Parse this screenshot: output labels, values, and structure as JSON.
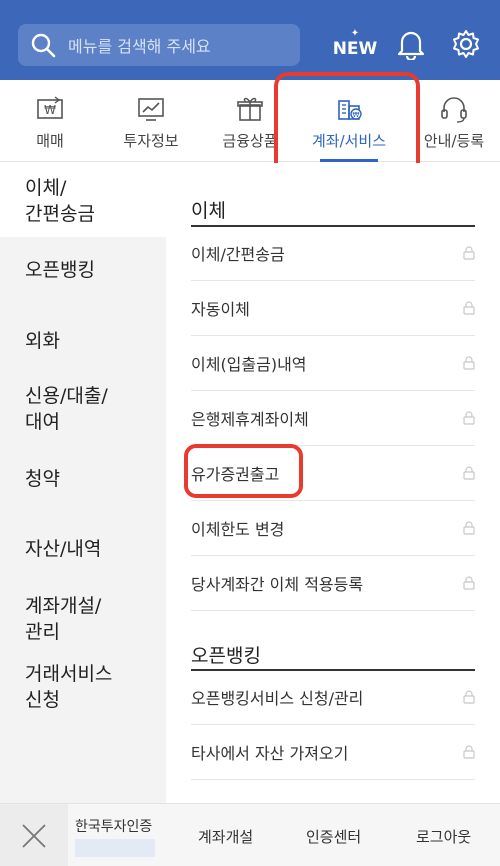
{
  "header": {
    "search_placeholder": "메뉴를 검색해 주세요",
    "new_label": "NEW",
    "brand_color": "#3d67b8"
  },
  "tabs": [
    {
      "label": "매매",
      "icon": "won-exchange-icon"
    },
    {
      "label": "투자정보",
      "icon": "chart-icon"
    },
    {
      "label": "금융상품",
      "icon": "gift-icon"
    },
    {
      "label": "계좌/서비스",
      "icon": "bank-building-icon",
      "active": true
    },
    {
      "label": "안내/등록",
      "icon": "headset-icon"
    }
  ],
  "sidebar": {
    "items": [
      {
        "label": "이체/\n간편송금",
        "active": true
      },
      {
        "label": "오픈뱅킹"
      },
      {
        "label": "외화"
      },
      {
        "label": "신용/대출/\n대여"
      },
      {
        "label": "청약"
      },
      {
        "label": "자산/내역"
      },
      {
        "label": "계좌개설/\n관리"
      },
      {
        "label": "거래서비스\n신청"
      }
    ]
  },
  "content": {
    "sections": [
      {
        "title": "이체",
        "items": [
          "이체/간편송금",
          "자동이체",
          "이체(입출금)내역",
          "은행제휴계좌이체",
          "유가증권출고",
          "이체한도 변경",
          "당사계좌간 이체 적용등록"
        ]
      },
      {
        "title": "오픈뱅킹",
        "items": [
          "오픈뱅킹서비스 신청/관리",
          "타사에서 자산 가져오기"
        ]
      }
    ]
  },
  "bottom": {
    "auth_label": "한국투자인증",
    "links": [
      "계좌개설",
      "인증센터",
      "로그아웃"
    ]
  },
  "highlight_color": "#e83a2e",
  "accent_color": "#2f63c4"
}
